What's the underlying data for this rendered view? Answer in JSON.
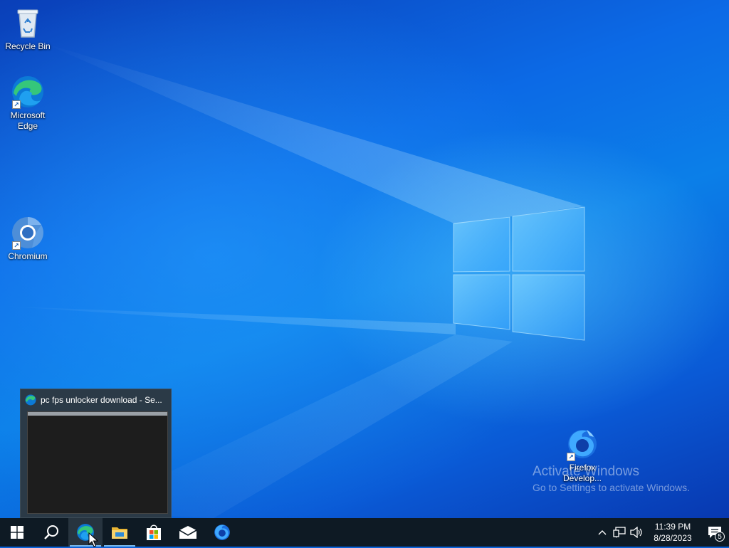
{
  "desktop": {
    "icons": [
      {
        "label": "Recycle Bin",
        "icon": "recycle-bin-icon"
      },
      {
        "label": "Microsoft Edge",
        "icon": "edge-icon"
      },
      {
        "label": "Chromium",
        "icon": "chromium-icon"
      },
      {
        "label": "Firefox Develop...",
        "icon": "firefox-developer-icon"
      }
    ]
  },
  "watermark": {
    "title": "Activate Windows",
    "subtitle": "Go to Settings to activate Windows."
  },
  "thumbnail": {
    "title": "pc fps unlocker download - Se..."
  },
  "taskbar": {
    "buttons": [
      {
        "name": "start",
        "icon": "windows-icon"
      },
      {
        "name": "search",
        "icon": "search-icon"
      },
      {
        "name": "edge",
        "icon": "edge-icon"
      },
      {
        "name": "file-explorer",
        "icon": "folder-icon"
      },
      {
        "name": "microsoft-store",
        "icon": "store-icon"
      },
      {
        "name": "mail",
        "icon": "mail-icon"
      },
      {
        "name": "firefox",
        "icon": "firefox-icon"
      }
    ],
    "tray": {
      "time": "11:39 PM",
      "date": "8/28/2023",
      "notification_count": "5"
    }
  },
  "colors": {
    "taskbar": "#0e1a24",
    "accent": "#7ab8e8",
    "desktop": "#0a62d8"
  }
}
